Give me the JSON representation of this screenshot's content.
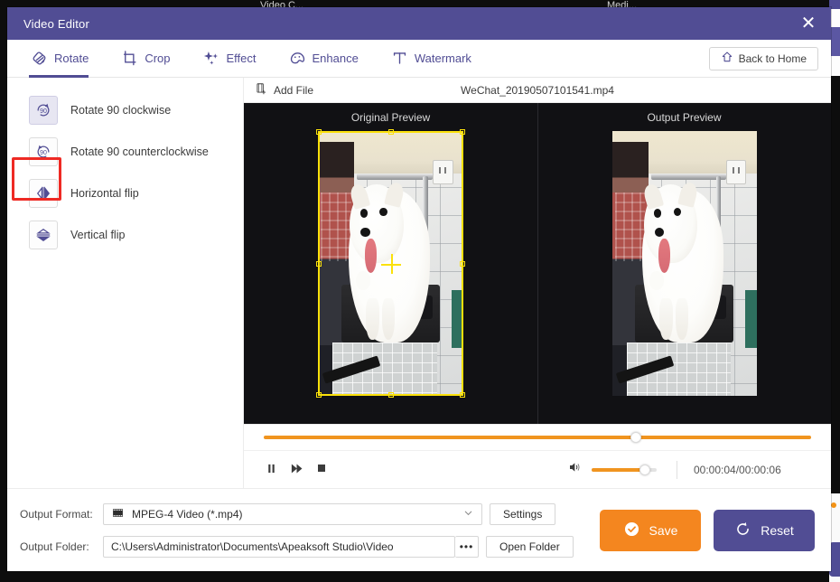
{
  "background": {
    "left_title": "Video C...",
    "right_title": "Medi..."
  },
  "window": {
    "title": "Video Editor",
    "close_label": "✕"
  },
  "tabs": [
    {
      "label": "Rotate",
      "icon": "rotate-icon",
      "active": true
    },
    {
      "label": "Crop",
      "icon": "crop-icon",
      "active": false
    },
    {
      "label": "Effect",
      "icon": "sparkle-icon",
      "active": false
    },
    {
      "label": "Enhance",
      "icon": "enhance-icon",
      "active": false
    },
    {
      "label": "Watermark",
      "icon": "text-t-icon",
      "active": false
    }
  ],
  "back_home": {
    "label": "Back to Home",
    "icon": "home-icon"
  },
  "sidebar": {
    "items": [
      {
        "label": "Rotate 90 clockwise",
        "icon": "rotate-cw-90-icon",
        "selected": true,
        "highlighted": true
      },
      {
        "label": "Rotate 90 counterclockwise",
        "icon": "rotate-ccw-90-icon",
        "selected": false,
        "highlighted": false
      },
      {
        "label": "Horizontal flip",
        "icon": "flip-horizontal-icon",
        "selected": false,
        "highlighted": false
      },
      {
        "label": "Vertical flip",
        "icon": "flip-vertical-icon",
        "selected": false,
        "highlighted": false
      }
    ]
  },
  "filebar": {
    "add_file_label": "Add File",
    "add_file_icon": "add-file-icon",
    "file_name": "WeChat_20190507101541.mp4"
  },
  "preview": {
    "original_title": "Original Preview",
    "output_title": "Output Preview"
  },
  "transport": {
    "seek_percent": 68,
    "buttons": [
      {
        "name": "pause-button",
        "icon": "pause-icon"
      },
      {
        "name": "fast-forward-button",
        "icon": "fast-forward-icon"
      },
      {
        "name": "stop-button",
        "icon": "stop-icon"
      }
    ],
    "volume_icon": "volume-icon",
    "volume_percent": 82,
    "time_label": "00:00:04/00:00:06",
    "current_time": "00:00:04",
    "total_time": "00:00:06"
  },
  "footer": {
    "format_label": "Output Format:",
    "format_value": "MPEG-4 Video (*.mp4)",
    "format_icon": "film-icon",
    "settings_label": "Settings",
    "folder_label": "Output Folder:",
    "folder_value": "C:\\Users\\Administrator\\Documents\\Apeaksoft Studio\\Video",
    "browse_label": "•••",
    "open_folder_label": "Open Folder",
    "save_label": "Save",
    "save_icon": "check-circle-icon",
    "reset_label": "Reset",
    "reset_icon": "reset-icon"
  },
  "colors": {
    "accent_purple": "#514d94",
    "accent_orange": "#f0941f",
    "save_orange": "#f4861f",
    "highlight_red": "#ee2a24",
    "crop_yellow": "#fbe10a",
    "stage_dark": "#111114"
  }
}
